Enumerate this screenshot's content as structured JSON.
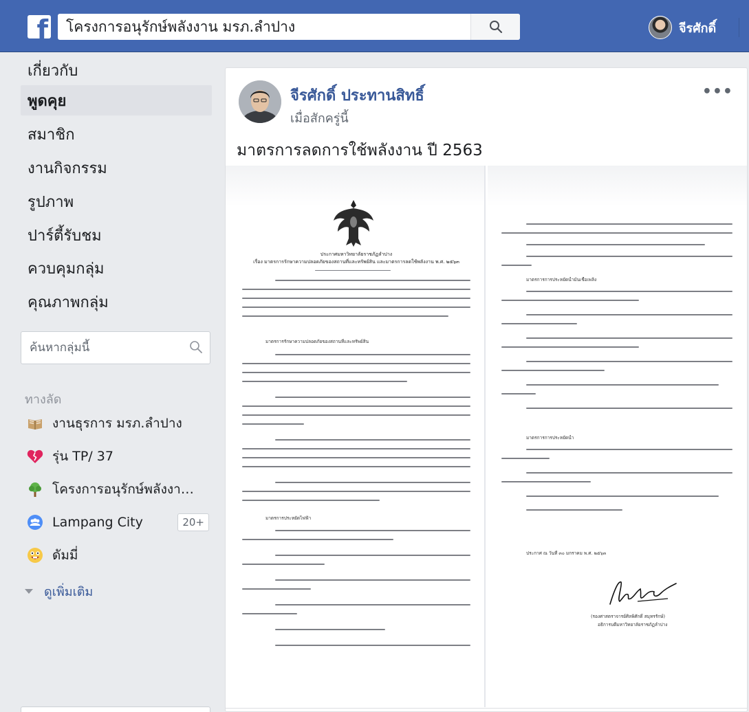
{
  "topbar": {
    "logo": "f",
    "search_value": "โครงการอนุรักษ์พลังงาน มรภ.ลำปาง",
    "profile_name": "จีรศักดิ์"
  },
  "nav": {
    "items": [
      {
        "label": "เกี่ยวกับ",
        "active": false
      },
      {
        "label": "พูดคุย",
        "active": true
      },
      {
        "label": "สมาชิก",
        "active": false
      },
      {
        "label": "งานกิจกรรม",
        "active": false
      },
      {
        "label": "รูปภาพ",
        "active": false
      },
      {
        "label": "ปาร์ตี้รับชม",
        "active": false
      },
      {
        "label": "ควบคุมกลุ่ม",
        "active": false
      },
      {
        "label": "คุณภาพกลุ่ม",
        "active": false
      }
    ],
    "group_search_placeholder": "ค้นหากลุ่มนี้",
    "shortcuts_title": "ทางลัด",
    "shortcuts": [
      {
        "icon": "book-icon",
        "label": "งานธุรการ มรภ.ลำปาง",
        "badge": ""
      },
      {
        "icon": "broken-heart-icon",
        "label": "รุ่น TP/ 37",
        "badge": ""
      },
      {
        "icon": "tree-icon",
        "label": "โครงการอนุรักษ์พลังงาน มรภ.ลำปาง",
        "badge": ""
      },
      {
        "icon": "group-icon",
        "label": "Lampang City",
        "badge": "20+"
      },
      {
        "icon": "emoji-face-icon",
        "label": "ดัมมี่",
        "badge": ""
      }
    ],
    "see_more": "ดูเพิ่มเติม"
  },
  "post": {
    "author": "จีรศักดิ์ ประทานสิทธิ์",
    "time": "เมื่อสักครู่นี้",
    "more": "•••",
    "text": "มาตรการลดการใช้พลังงาน ปี 2563"
  },
  "doc1": {
    "heading1": "ประกาศมหาวิทยาลัยราชภัฏลำปาง",
    "heading2": "เรื่อง มาตรการรักษาความปลอดภัยของสถานที่และทรัพย์สิน และมาตรการลดใช้พลังงาน พ.ศ. ๒๕๖๓",
    "section1": "มาตรการรักษาความปลอดภัยของสถานที่และทรัพย์สิน",
    "section2": "มาตรการประหยัดไฟฟ้า"
  },
  "doc2": {
    "section1": "มาตรการการประหยัดน้ำมันเชื้อเพลิง",
    "section2": "มาตรการการประหยัดน้ำ",
    "date": "ประกาศ ณ วันที่ ๓๐ มกราคม พ.ศ. ๒๕๖๓",
    "signer": "(รองศาสตราจารย์ศิลพิศักดิ์ สมุทรรักษ์)",
    "signer_title": "อธิการบดีมหาวิทยาลัยราชภัฏลำปาง"
  },
  "colors": {
    "topbar": "#4267b2",
    "link": "#385898",
    "page_bg": "#e9ebee"
  }
}
